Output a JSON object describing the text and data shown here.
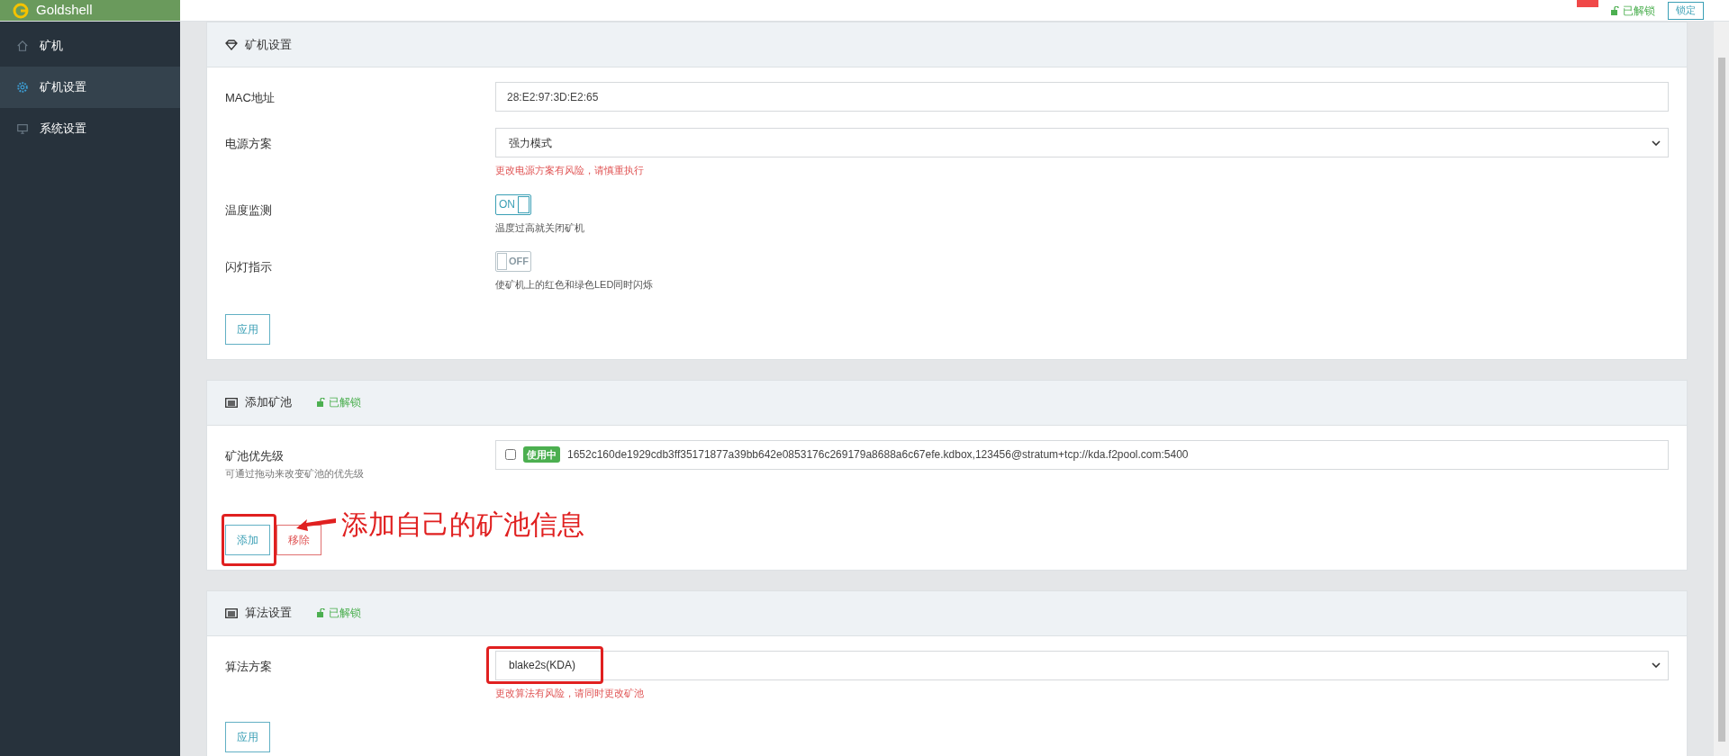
{
  "brand": "Goldshell",
  "topbar": {
    "lock_status": "已解锁",
    "lock_button": "锁定"
  },
  "sidebar": {
    "items": [
      {
        "label": "矿机",
        "selected": false
      },
      {
        "label": "矿机设置",
        "selected": true
      },
      {
        "label": "系统设置",
        "selected": false
      }
    ]
  },
  "sections": [
    {
      "title": "矿机设置",
      "rows": [
        {
          "kind": "input",
          "label": "MAC地址",
          "value": "28:E2:97:3D:E2:65"
        },
        {
          "kind": "select",
          "label": "电源方案",
          "value": "强力模式",
          "highlighted": false,
          "hint": "更改电源方案有风险，请慎重执行",
          "warning": true
        },
        {
          "kind": "switch",
          "label": "温度监测",
          "on": true,
          "switch_text": "ON",
          "hint": "温度过高就关闭矿机",
          "warning": false
        },
        {
          "kind": "switch",
          "label": "闪灯指示",
          "on": false,
          "switch_text": "OFF",
          "hint": "使矿机上的红色和绿色LED同时闪烁",
          "warning": false
        }
      ],
      "buttons": [
        {
          "label": "应用",
          "kind": "primary",
          "highlighted": false
        }
      ]
    },
    {
      "title": "添加矿池",
      "lock": "已解锁",
      "rows": [
        {
          "kind": "pool",
          "label": "矿池优先级",
          "sublabel": "可通过拖动来改变矿池的优先级",
          "checked": false,
          "badge": "使用中",
          "value": "1652c160de1929cdb3ff35171877a39bb642e0853176c269179a8688a6c67efe.kdbox,123456@stratum+tcp://kda.f2pool.com:5400"
        }
      ],
      "buttons": [
        {
          "label": "添加",
          "kind": "primary",
          "highlighted": true
        },
        {
          "label": "移除",
          "kind": "danger",
          "highlighted": false
        }
      ],
      "annotation": "添加自己的矿池信息"
    },
    {
      "title": "算法设置",
      "lock": "已解锁",
      "rows": [
        {
          "kind": "select",
          "label": "算法方案",
          "value": "blake2s(KDA)",
          "highlighted": true,
          "hint": "更改算法有风险，请同时更改矿池",
          "warning": true
        }
      ],
      "buttons": [
        {
          "label": "应用",
          "kind": "primary",
          "highlighted": false
        }
      ]
    }
  ]
}
